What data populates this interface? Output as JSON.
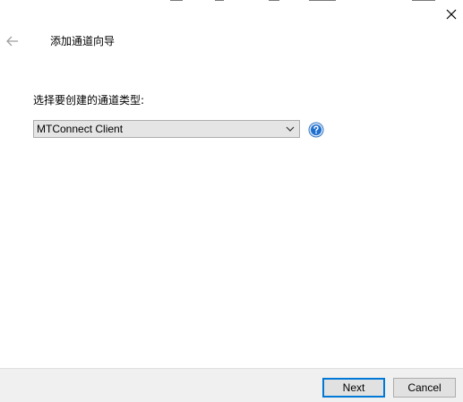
{
  "header": {
    "title": "添加通道向导",
    "back_icon": "arrow-left-icon",
    "close_icon": "close-icon"
  },
  "main": {
    "prompt": "选择要创建的通道类型:",
    "channel_type": {
      "selected": "MTConnect Client",
      "chevron_icon": "chevron-down-icon"
    },
    "help_icon": "question-mark-icon"
  },
  "footer": {
    "next_label": "Next",
    "cancel_label": "Cancel"
  },
  "colors": {
    "accent_border": "#0078d7",
    "help_icon_fill": "#1e6fcf",
    "footer_background": "#f0f0f0"
  }
}
